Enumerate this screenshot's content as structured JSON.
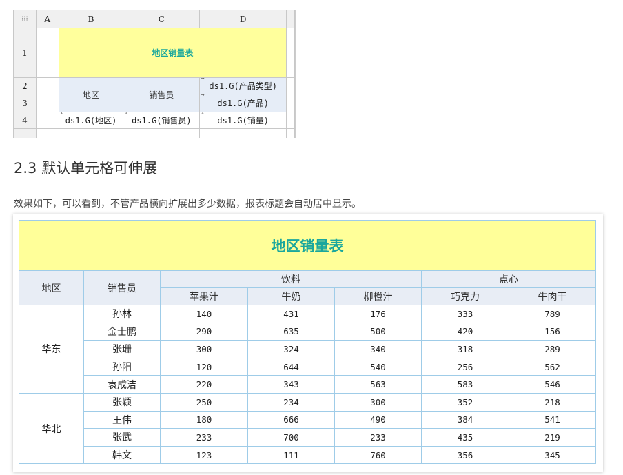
{
  "designer": {
    "col_headers": [
      "A",
      "B",
      "C",
      "D"
    ],
    "row_headers": [
      "1",
      "2",
      "3",
      "4"
    ],
    "title": "地区销量表",
    "header_region": "地区",
    "header_seller": "销售员",
    "cell_product_type": "ds1.G(产品类型)",
    "cell_product": "ds1.G(产品)",
    "cell_region": "ds1.G(地区)",
    "cell_seller": "ds1.G(销售员)",
    "cell_sales": "ds1.G(销量)"
  },
  "section_heading": "2.3 默认单元格可伸展",
  "intro_text": "效果如下，可以看到，不管产品横向扩展出多少数据，报表标题会自动居中显示。",
  "report": {
    "title": "地区销量表",
    "header_region": "地区",
    "header_seller": "销售员",
    "groups": [
      {
        "label": "饮料",
        "products": [
          "苹果汁",
          "牛奶",
          "柳橙汁"
        ]
      },
      {
        "label": "点心",
        "products": [
          "巧克力",
          "牛肉干"
        ]
      }
    ],
    "regions": [
      {
        "name": "华东",
        "rows": [
          {
            "seller": "孙林",
            "values": [
              "140",
              "431",
              "176",
              "333",
              "789"
            ]
          },
          {
            "seller": "金士鹏",
            "values": [
              "290",
              "635",
              "500",
              "420",
              "156"
            ]
          },
          {
            "seller": "张珊",
            "values": [
              "300",
              "324",
              "340",
              "318",
              "289"
            ]
          },
          {
            "seller": "孙阳",
            "values": [
              "120",
              "644",
              "540",
              "256",
              "562"
            ]
          },
          {
            "seller": "袁成洁",
            "values": [
              "220",
              "343",
              "563",
              "583",
              "546"
            ]
          }
        ]
      },
      {
        "name": "华北",
        "rows": [
          {
            "seller": "张颖",
            "values": [
              "250",
              "234",
              "300",
              "352",
              "218"
            ]
          },
          {
            "seller": "王伟",
            "values": [
              "180",
              "666",
              "490",
              "384",
              "541"
            ]
          },
          {
            "seller": "张武",
            "values": [
              "233",
              "700",
              "233",
              "435",
              "219"
            ]
          },
          {
            "seller": "韩文",
            "values": [
              "123",
              "111",
              "760",
              "356",
              "345"
            ]
          }
        ]
      }
    ]
  },
  "colors": {
    "title_text": "#1aa79d",
    "title_bg": "#ffff99",
    "header_bg": "#e8edf5",
    "border": "#9fcce8"
  }
}
